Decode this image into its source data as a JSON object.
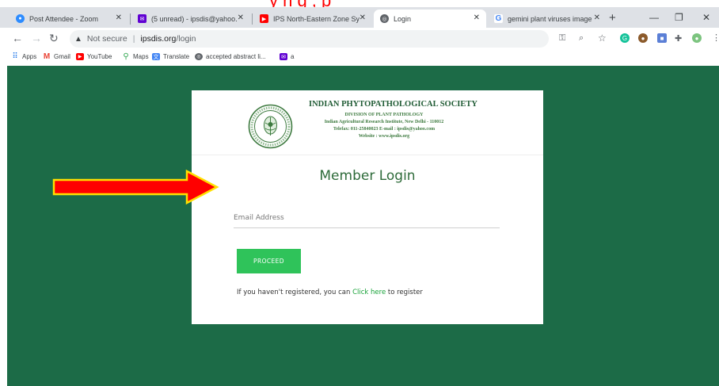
{
  "colors": {
    "page_bg": "#1c6b47",
    "accent_green": "#2fc35a",
    "link_green": "#19a33a",
    "title_green": "#2e6b3a",
    "arrow_fill": "#ff0000",
    "arrow_outline": "#ffe000",
    "caption_red": "#ff0000"
  },
  "caption_fragment": "y      n    g   ,                                                 p",
  "tabs": [
    {
      "title": "Post Attendee - Zoom",
      "icon": "zoom-icon",
      "active": false
    },
    {
      "title": "(5 unread) - ipsdis@yahoo.",
      "icon": "yahoo-mail-icon",
      "active": false
    },
    {
      "title": "IPS North-Eastern Zone Sy",
      "icon": "youtube-icon",
      "active": false
    },
    {
      "title": "Login",
      "icon": "globe-icon",
      "active": true
    },
    {
      "title": "gemini plant viruses image",
      "icon": "google-icon",
      "active": false
    }
  ],
  "address_bar": {
    "security_label": "Not secure",
    "host": "ipsdis.org",
    "path": "/login"
  },
  "bookmarks": [
    {
      "label": "Apps",
      "icon": "apps-grid-icon"
    },
    {
      "label": "Gmail",
      "icon": "gmail-icon"
    },
    {
      "label": "YouTube",
      "icon": "youtube-icon"
    },
    {
      "label": "Maps",
      "icon": "maps-pin-icon"
    },
    {
      "label": "Translate",
      "icon": "translate-icon"
    },
    {
      "label": "accepted abstract li...",
      "icon": "globe-icon"
    },
    {
      "label": "a",
      "icon": "yahoo-mail-icon"
    }
  ],
  "header": {
    "org_name": "INDIAN PHYTOPATHOLOGICAL SOCIETY",
    "division": "DIVISION OF PLANT PATHOLOGY",
    "institute": "Indian Agricultural Research Institute, New Delhi - 110012",
    "contact": "Telefax: 011-25840023  E-mail : ipsdis@yahoo.com",
    "website": "Website : www.ipsdis.org"
  },
  "login": {
    "title": "Member Login",
    "email_placeholder": "Email Address",
    "email_value": "",
    "proceed_label": "PROCEED",
    "register_prefix": "If you haven't registered, you can ",
    "register_link": "Click here",
    "register_suffix": " to register"
  }
}
